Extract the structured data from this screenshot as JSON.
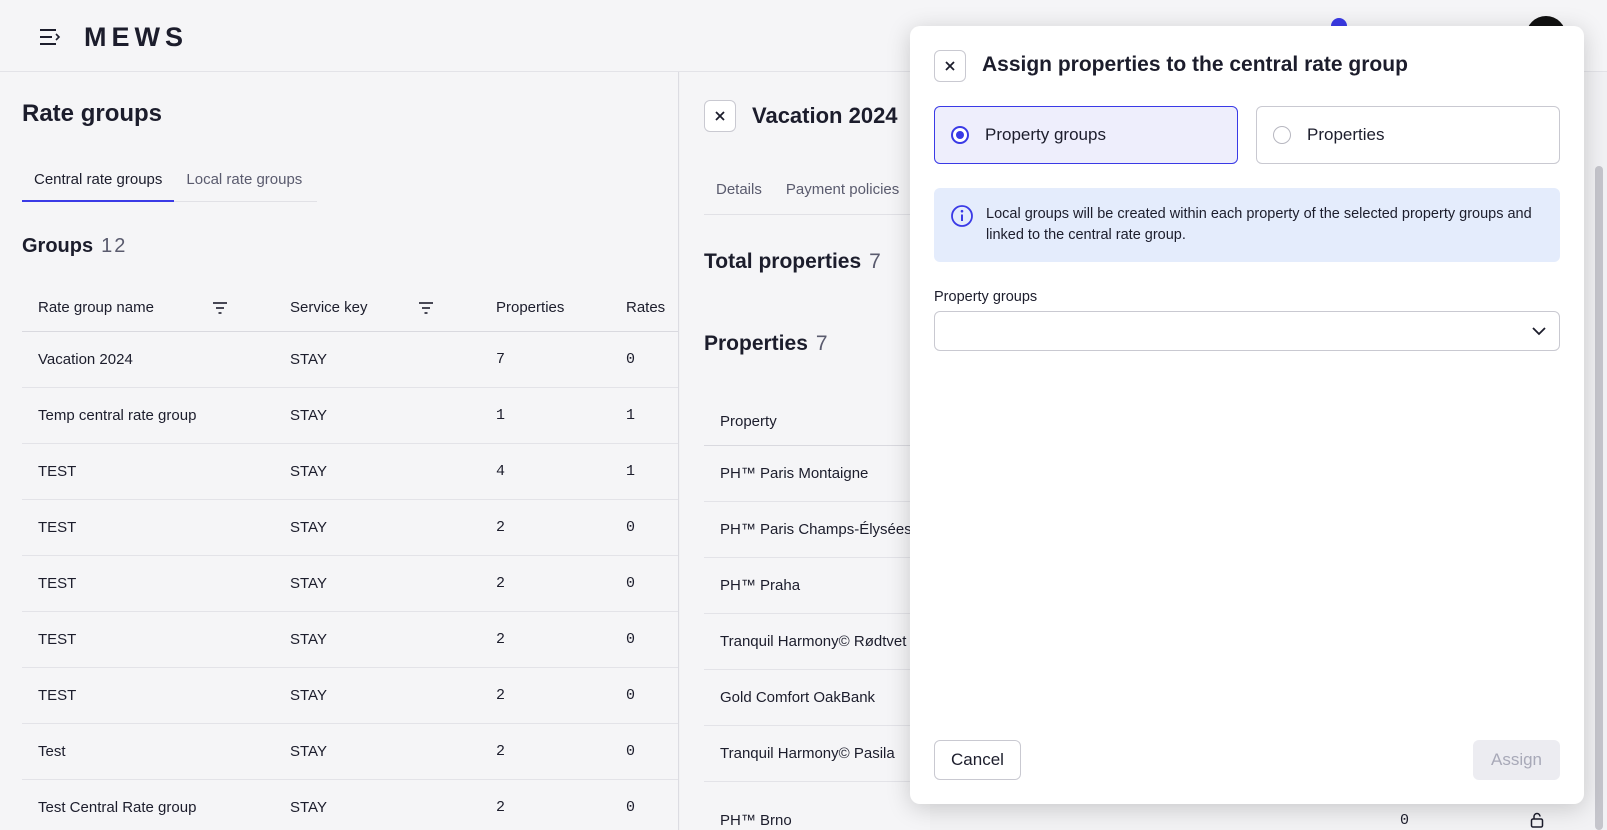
{
  "app": {
    "logo": "MEWS"
  },
  "left": {
    "title": "Rate groups",
    "tabs": [
      {
        "label": "Central rate groups",
        "active": true
      },
      {
        "label": "Local rate groups",
        "active": false
      }
    ],
    "groups_label": "Groups",
    "groups_count": "12",
    "columns": [
      "Rate group name",
      "Service key",
      "Properties",
      "Rates"
    ],
    "rows": [
      {
        "name": "Vacation 2024",
        "service_key": "STAY",
        "properties": "7",
        "rates": "0"
      },
      {
        "name": "Temp central rate group",
        "service_key": "STAY",
        "properties": "1",
        "rates": "1"
      },
      {
        "name": "TEST",
        "service_key": "STAY",
        "properties": "4",
        "rates": "1"
      },
      {
        "name": "TEST",
        "service_key": "STAY",
        "properties": "2",
        "rates": "0"
      },
      {
        "name": "TEST",
        "service_key": "STAY",
        "properties": "2",
        "rates": "0"
      },
      {
        "name": "TEST",
        "service_key": "STAY",
        "properties": "2",
        "rates": "0"
      },
      {
        "name": "TEST",
        "service_key": "STAY",
        "properties": "2",
        "rates": "0"
      },
      {
        "name": "Test",
        "service_key": "STAY",
        "properties": "2",
        "rates": "0"
      },
      {
        "name": "Test Central Rate group",
        "service_key": "STAY",
        "properties": "2",
        "rates": "0"
      }
    ]
  },
  "detail": {
    "title": "Vacation 2024",
    "tabs": [
      "Details",
      "Payment policies"
    ],
    "total_label": "Total properties",
    "total_count": "7",
    "properties_label": "Properties",
    "properties_count": "7",
    "column": "Property",
    "properties": [
      "PH™ Paris Montaigne",
      "PH™ Paris Champs-Élysées",
      "PH™ Praha",
      "Tranquil Harmony© Rødtvet",
      "Gold Comfort OakBank",
      "Tranquil Harmony© Pasila"
    ],
    "partial_row": {
      "name": "PH™ Brno",
      "value": "0"
    }
  },
  "modal": {
    "title": "Assign properties to the central rate group",
    "options": [
      {
        "label": "Property groups",
        "selected": true
      },
      {
        "label": "Properties",
        "selected": false
      }
    ],
    "info": "Local groups will be created within each property of the selected property groups and linked to the central rate group.",
    "field_label": "Property groups",
    "field_value": "",
    "cancel_label": "Cancel",
    "assign_label": "Assign"
  },
  "colors": {
    "accent": "#3a3ae6",
    "info_bg": "#e4ecfc",
    "disabled_text": "#a8a9b8"
  },
  "icons": [
    "menu-icon",
    "close-icon",
    "filter-icon",
    "info-icon",
    "chevron-down-icon",
    "lock-icon",
    "radio-selected-icon",
    "radio-unselected-icon"
  ]
}
